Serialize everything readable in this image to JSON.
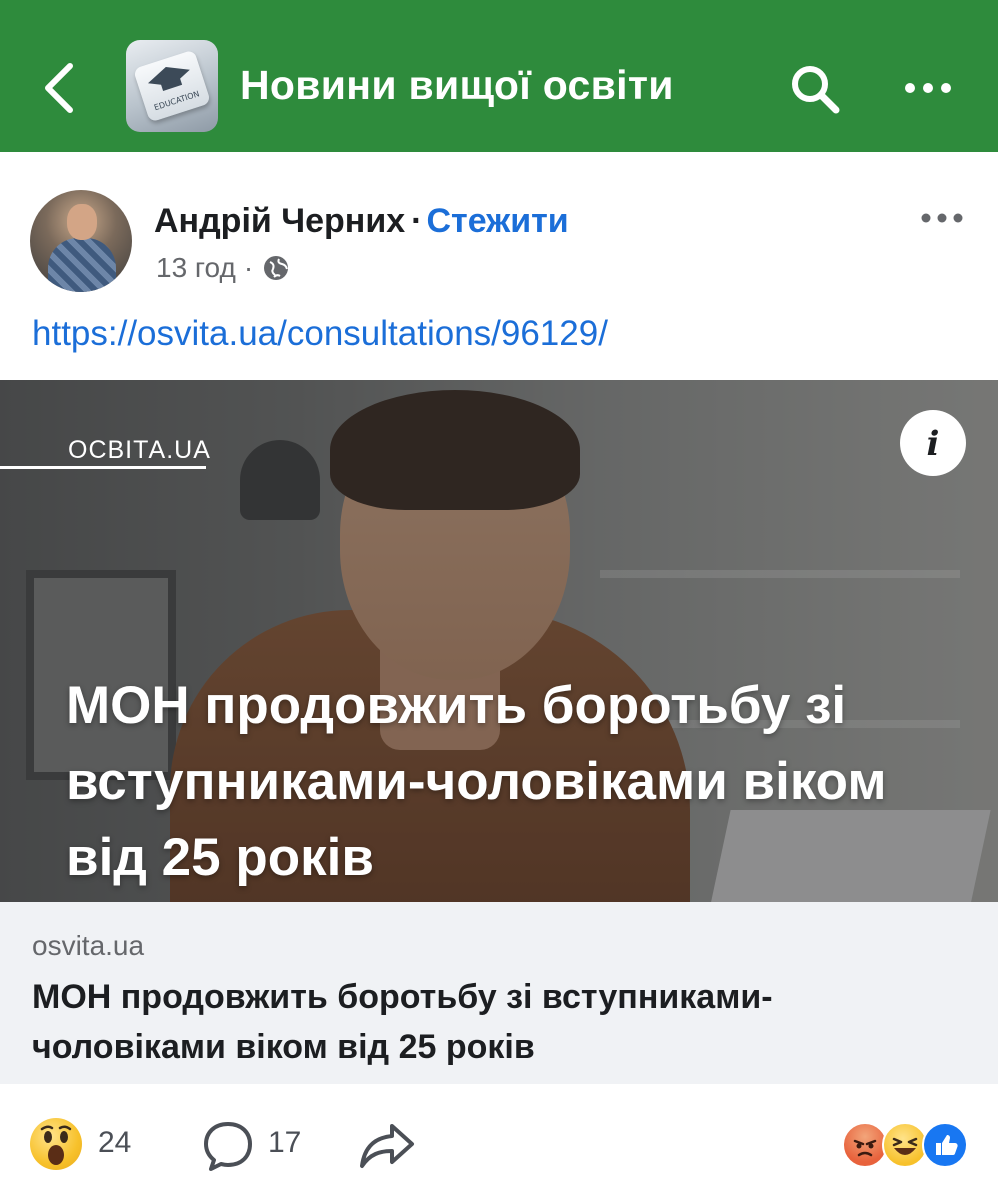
{
  "header": {
    "title": "Новини вищої освіти",
    "group_thumb_text": "EDUCATION"
  },
  "post": {
    "author": "Андрій Черних",
    "separator": "·",
    "follow_label": "Стежити",
    "time": "13 год",
    "meta_separator": "·",
    "link_text": "https://osvita.ua/consultations/96129/"
  },
  "preview": {
    "source_label": "ОСВІТА.UA",
    "info_label": "i",
    "overlay_headline": "МОН продовжить боротьбу зі вступниками-чоловіками віком від 25 років",
    "domain": "osvita.ua",
    "title": "МОН продовжить боротьбу зі вступниками-чоловіками віком від 25 років"
  },
  "footer": {
    "wow_count": "24",
    "comment_count": "17"
  },
  "colors": {
    "header_bg": "#2e8b3c",
    "link": "#1b6ed8",
    "caption_bg": "#f0f2f5"
  },
  "icons": [
    "back-icon",
    "search-icon",
    "more-icon",
    "globe-icon",
    "info-icon",
    "wow-emoji-icon",
    "comment-icon",
    "share-icon",
    "angry-icon",
    "haha-icon",
    "like-icon"
  ]
}
